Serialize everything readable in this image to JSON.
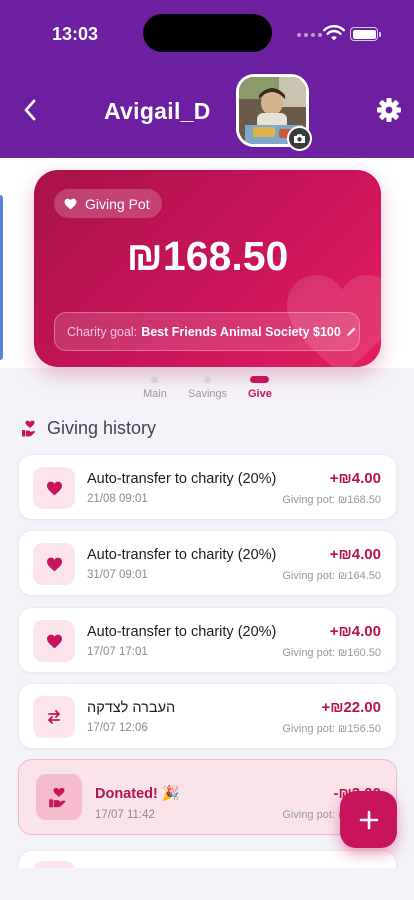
{
  "status_bar": {
    "time": "13:03"
  },
  "header": {
    "username": "Avigail_D"
  },
  "pot_card": {
    "badge_label": "Giving Pot",
    "amount": "₪168.50",
    "goal_label": "Charity goal:",
    "goal_value": "Best Friends Animal Society $100"
  },
  "pager": {
    "items": [
      {
        "label": "Main",
        "active": false
      },
      {
        "label": "Savings",
        "active": false
      },
      {
        "label": "Give",
        "active": true
      }
    ]
  },
  "history": {
    "title": "Giving history",
    "transactions": [
      {
        "kind": "heart",
        "title": "Auto-transfer to charity (20%)",
        "date": "21/08  09:01",
        "amount": "+₪4.00",
        "pot": "Giving pot: ₪168.50"
      },
      {
        "kind": "heart",
        "title": "Auto-transfer to charity (20%)",
        "date": "31/07  09:01",
        "amount": "+₪4.00",
        "pot": "Giving pot: ₪164.50"
      },
      {
        "kind": "heart",
        "title": "Auto-transfer to charity (20%)",
        "date": "17/07  17:01",
        "amount": "+₪4.00",
        "pot": "Giving pot: ₪160.50"
      },
      {
        "kind": "transfer",
        "title": "העברה לצדקה",
        "date": "17/07  12:06",
        "amount": "+₪22.00",
        "pot": "Giving pot: ₪156.50"
      },
      {
        "kind": "donated",
        "title": "Donated! 🎉",
        "date": "17/07  11:42",
        "amount": "-₪3.00",
        "pot": "Giving pot: ₪134.50"
      }
    ]
  },
  "colors": {
    "header": "#6c1fa0",
    "accent": "#c8145a",
    "card_start": "#a9124a",
    "card_end": "#e51d5f"
  },
  "icons": {
    "back": "chevron-left-icon",
    "settings": "gear-icon",
    "camera": "camera-icon",
    "heart": "heart-icon",
    "transfer": "swap-arrows-icon",
    "donate": "hand-heart-icon",
    "add": "plus-icon"
  }
}
